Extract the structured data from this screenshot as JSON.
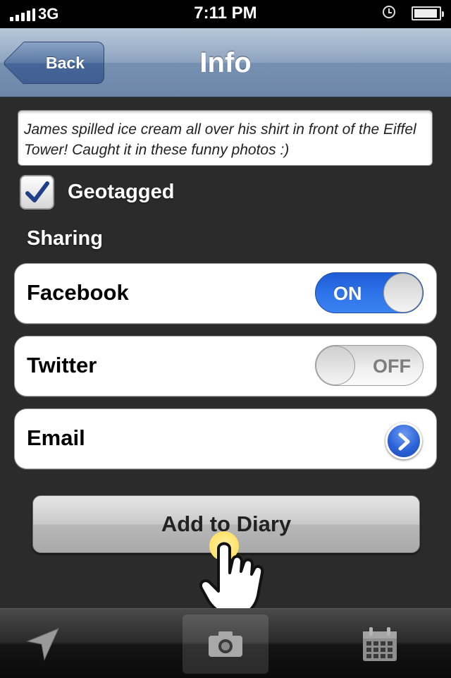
{
  "status_bar": {
    "carrier": "3G",
    "time": "7:11 PM",
    "battery_level": 0.95,
    "icons": [
      "signal-bars-icon",
      "clock-lock-icon",
      "battery-icon"
    ]
  },
  "navbar": {
    "back_label": "Back",
    "title": "Info"
  },
  "caption": {
    "text": "James spilled ice cream all over his shirt in front of the Eiffel Tower! Caught it in these funny photos :)"
  },
  "geotagged": {
    "label": "Geotagged",
    "checked": true
  },
  "sharing": {
    "heading": "Sharing",
    "items": [
      {
        "label": "Facebook",
        "control": "toggle",
        "state": "ON",
        "on": true
      },
      {
        "label": "Twitter",
        "control": "toggle",
        "state": "OFF",
        "on": false
      },
      {
        "label": "Email",
        "control": "disclosure",
        "icon": "chevron-right-icon"
      }
    ]
  },
  "add_button": {
    "label": "Add to Diary"
  },
  "tabbar": {
    "tabs": [
      {
        "icon": "location-arrow-icon",
        "selected": false
      },
      {
        "icon": "camera-icon",
        "selected": true
      },
      {
        "icon": "calendar-icon",
        "selected": false
      }
    ]
  },
  "colors": {
    "toggle_on": "#2f74ea",
    "nav_blue": "#7690b1",
    "touch_indicator": "#ffe26a"
  }
}
